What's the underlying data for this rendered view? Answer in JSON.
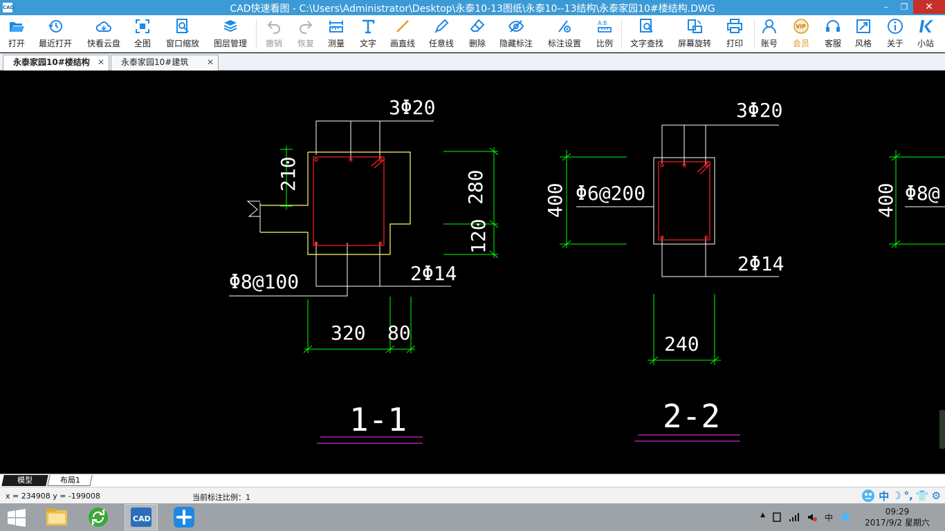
{
  "window": {
    "title": "CAD快速看图 - C:\\Users\\Administrator\\Desktop\\永泰10-13图纸\\永泰10--13结构\\永泰家园10#楼结构.DWG",
    "icon_text": "CAD",
    "minimize": "–",
    "restore": "❐",
    "close": "✕"
  },
  "toolbar": {
    "items": [
      {
        "label": "打开",
        "icon": "folder-open-icon"
      },
      {
        "label": "最近打开",
        "icon": "recent-clock-icon"
      },
      {
        "label": "快看云盘",
        "icon": "cloud-icon"
      },
      {
        "label": "全图",
        "icon": "fit-all-icon"
      },
      {
        "label": "窗口缩放",
        "icon": "zoom-window-icon"
      },
      {
        "label": "图层管理",
        "icon": "layers-icon"
      },
      {
        "label": "撤销",
        "icon": "undo-icon"
      },
      {
        "label": "恢复",
        "icon": "redo-icon"
      },
      {
        "label": "测量",
        "icon": "ruler-icon"
      },
      {
        "label": "文字",
        "icon": "text-icon"
      },
      {
        "label": "画直线",
        "icon": "line-icon"
      },
      {
        "label": "任意线",
        "icon": "pen-icon"
      },
      {
        "label": "删除",
        "icon": "eraser-icon"
      },
      {
        "label": "隐藏标注",
        "icon": "hide-eye-icon"
      },
      {
        "label": "标注设置",
        "icon": "dimension-settings-icon"
      },
      {
        "label": "比例",
        "icon": "scale-icon"
      },
      {
        "label": "文字查找",
        "icon": "text-search-icon"
      },
      {
        "label": "屏幕旋转",
        "icon": "rotate-screen-icon"
      },
      {
        "label": "打印",
        "icon": "printer-icon"
      },
      {
        "label": "账号",
        "icon": "user-icon"
      },
      {
        "label": "会员",
        "icon": "vip-icon"
      },
      {
        "label": "客服",
        "icon": "headset-icon"
      },
      {
        "label": "风格",
        "icon": "style-icon"
      },
      {
        "label": "关于",
        "icon": "info-icon"
      },
      {
        "label": "小站",
        "icon": "station-k-icon"
      }
    ]
  },
  "doc_tabs": [
    {
      "label": "永泰家园10#楼结构",
      "close": "✕",
      "active": true
    },
    {
      "label": "永泰家园10#建筑",
      "close": "✕",
      "active": false
    }
  ],
  "drawing": {
    "section_1": {
      "top_bars": "3Φ20",
      "dim_210": "210",
      "dim_280": "280",
      "dim_120": "120",
      "bottom_bars": "2Φ14",
      "stirrup": "Φ8@100",
      "dim_320": "320",
      "dim_80": "80",
      "title": "1-1"
    },
    "section_2": {
      "top_bars": "3Φ20",
      "dim_400": "400",
      "stirrup": "Φ6@200",
      "bottom_bars": "2Φ14",
      "dim_240": "240",
      "title": "2-2"
    },
    "section_3_partial": {
      "dim_400": "400",
      "stirrup": "Φ8@"
    },
    "colors": {
      "background": "#000000",
      "outline": "#ffffff",
      "concrete": "#ffff66",
      "rebar": "#ff2020",
      "dimension": "#00ff00",
      "underline": "#ff33ff"
    }
  },
  "layout_tabs": [
    {
      "label": "模型",
      "active": true
    },
    {
      "label": "布局1",
      "active": false
    }
  ],
  "status": {
    "coords": "x = 234908  y = -199008",
    "scale_label": "当前标注比例：1"
  },
  "ime": {
    "lang": "中",
    "moon": "☽",
    "punct": "°,",
    "shirt": "👕",
    "gear": "⚙"
  },
  "taskbar": {
    "apps": [
      "file-explorer-icon",
      "green-refresh-icon",
      "cad-viewer-icon",
      "blue-pinwheel-icon"
    ],
    "cad_label": "CAD",
    "tray": {
      "up_arrow": "▲",
      "ime": "中",
      "time": "09:29",
      "date": "2017/9/2 星期六"
    }
  }
}
